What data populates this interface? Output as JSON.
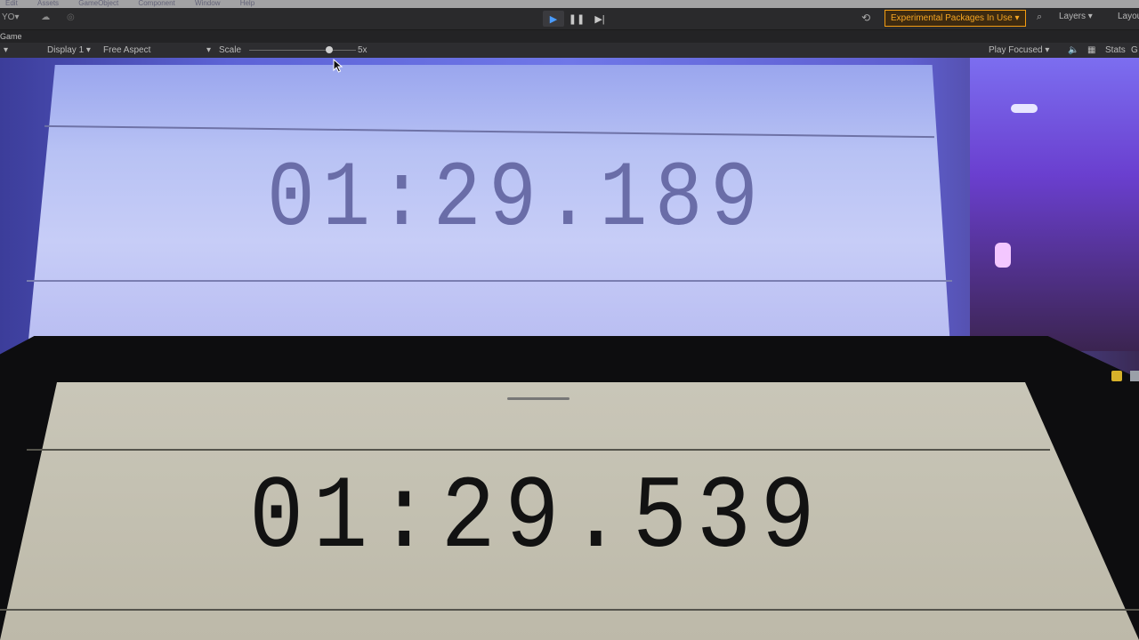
{
  "menubar": {
    "items": [
      "Edit",
      "Assets",
      "GameObject",
      "Component",
      "Window",
      "Help"
    ]
  },
  "toolbar": {
    "account_label": "YO",
    "play_icon": "play-icon",
    "pause_icon": "pause-icon",
    "step_icon": "step-icon",
    "experimental_label": "Experimental Packages In Use ▾",
    "layers_label": "Layers",
    "layout_label": "Layou"
  },
  "panel": {
    "tab_label": "Game"
  },
  "gamebar": {
    "display_label": "Display 1",
    "aspect_label": "Free Aspect",
    "scale_label": "Scale",
    "scale_value": "5x",
    "scale_fraction": 0.75,
    "play_focused_label": "Play Focused",
    "stats_label": "Stats",
    "gizmos_label": "G"
  },
  "game_view": {
    "monitor_timer": "01:29.189",
    "ipad_timer": "01:29.539"
  },
  "colors": {
    "accent_play": "#4a9cff",
    "experimental_border": "#f39c12",
    "experimental_text": "#f5a623"
  }
}
